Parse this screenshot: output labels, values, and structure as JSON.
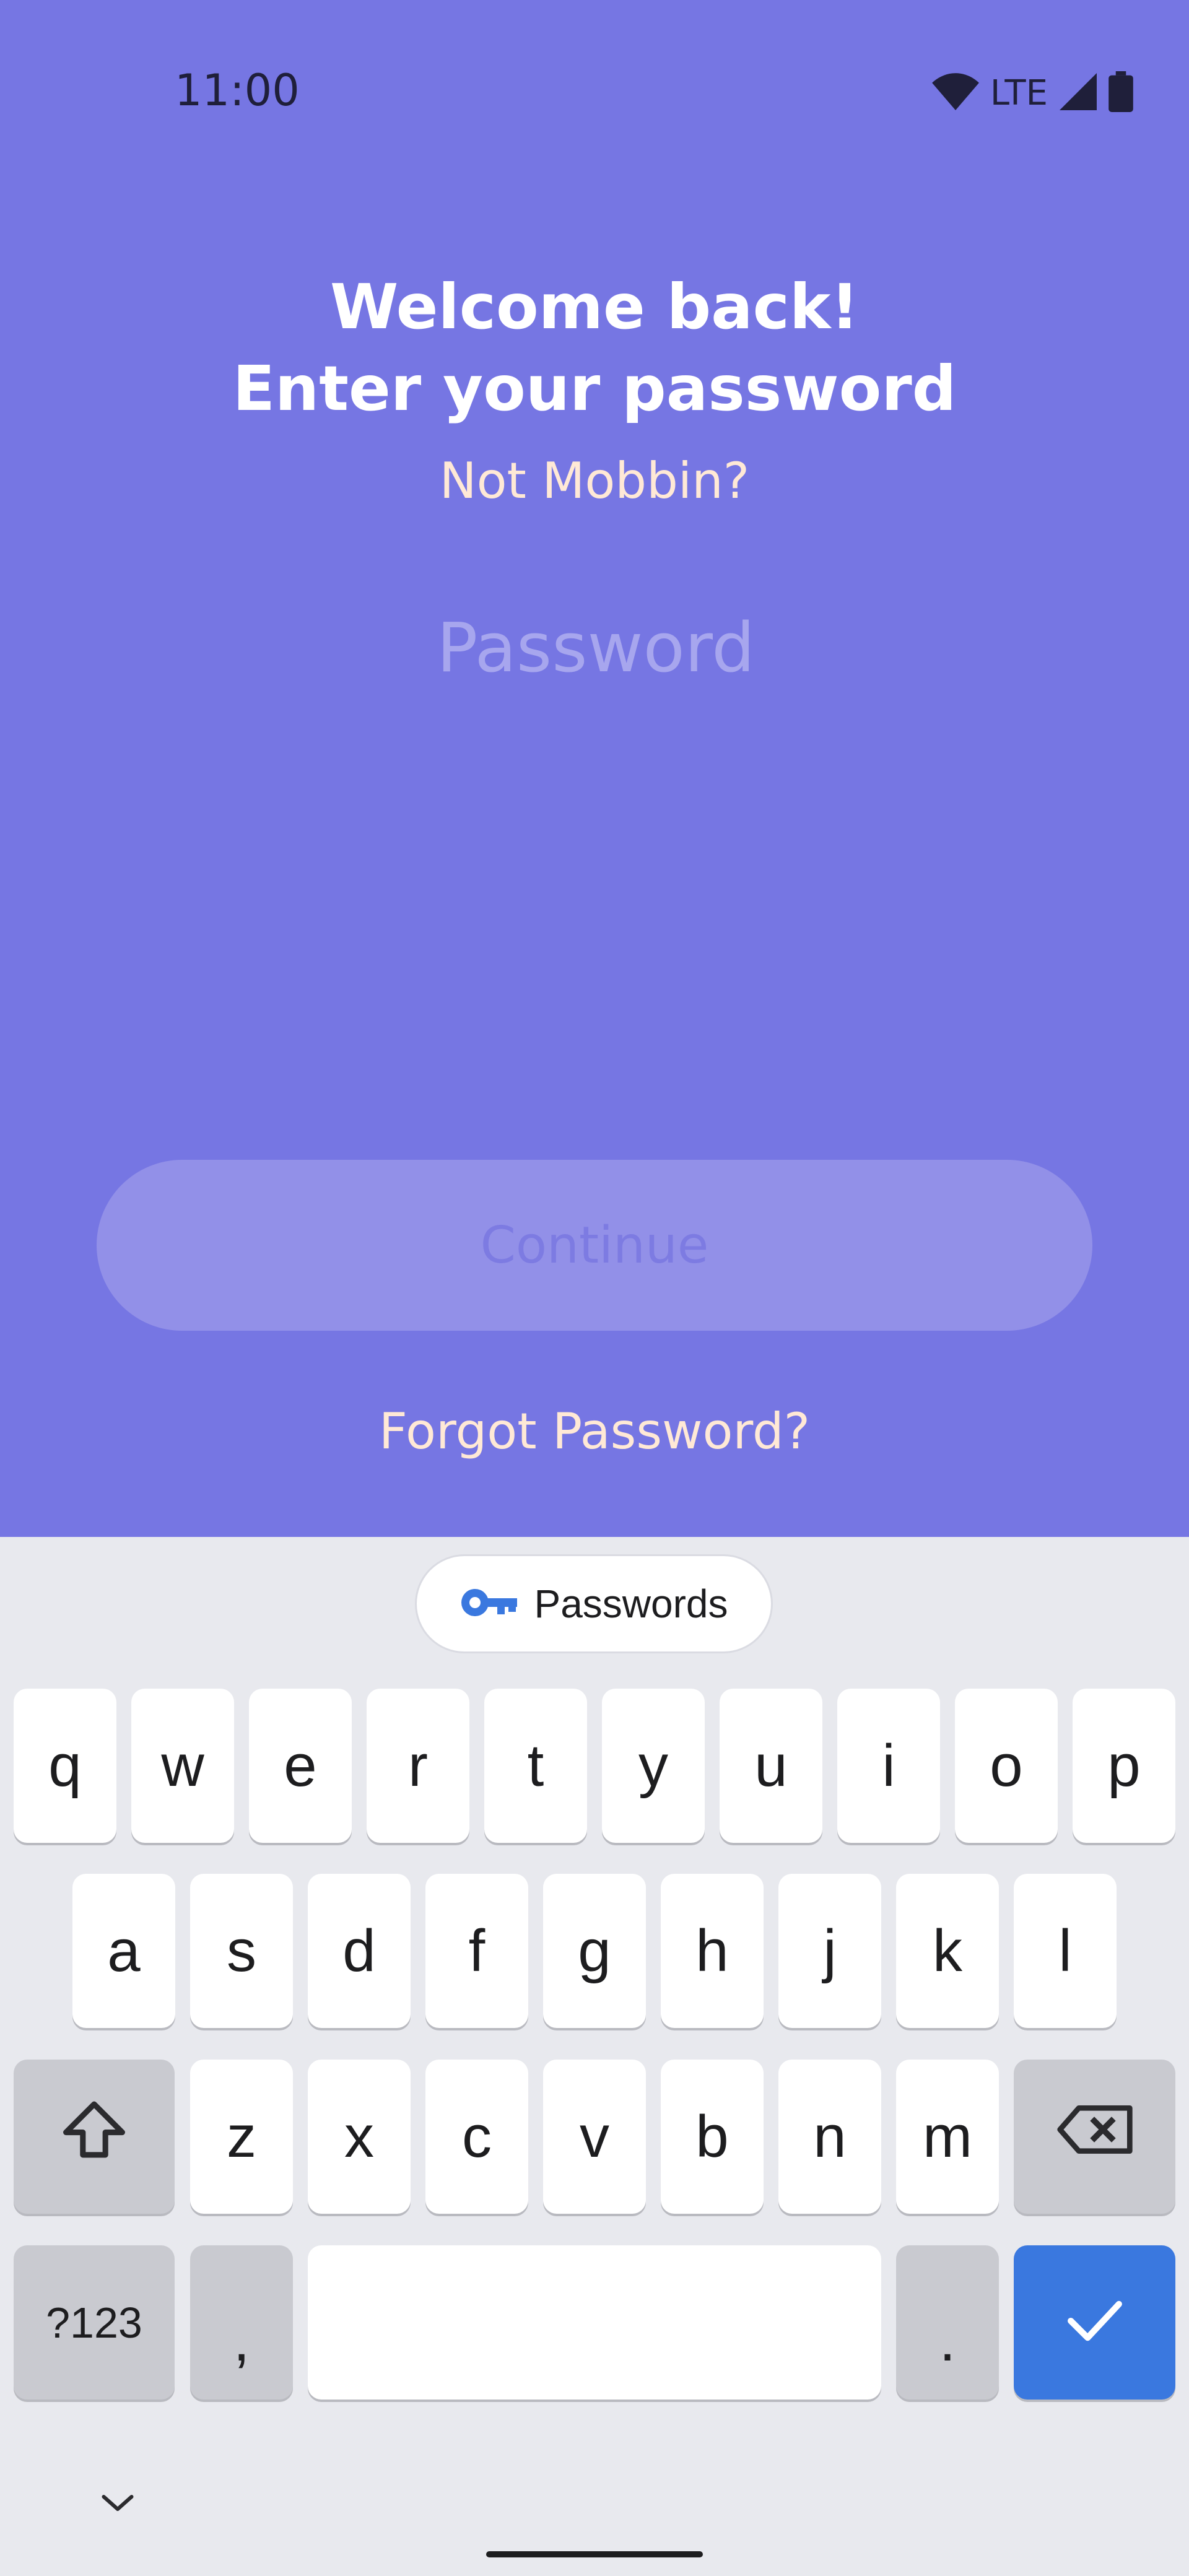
{
  "status_bar": {
    "time": "11:00",
    "network": "LTE",
    "icons": [
      "wifi-icon",
      "signal-icon",
      "battery-icon"
    ]
  },
  "login": {
    "title_line1": "Welcome back!",
    "title_line2": "Enter your password",
    "not_user_link": "Not Mobbin?",
    "password_placeholder": "Password",
    "password_value": "",
    "continue_label": "Continue",
    "forgot_link": "Forgot Password?"
  },
  "keyboard": {
    "suggestion_chip": {
      "label": "Passwords",
      "icon": "key-icon"
    },
    "row1": [
      "q",
      "w",
      "e",
      "r",
      "t",
      "y",
      "u",
      "i",
      "o",
      "p"
    ],
    "row2": [
      "a",
      "s",
      "d",
      "f",
      "g",
      "h",
      "j",
      "k",
      "l"
    ],
    "row3": [
      "z",
      "x",
      "c",
      "v",
      "b",
      "n",
      "m"
    ],
    "symbols_key": "?123",
    "comma_key": ",",
    "period_key": ".",
    "accent_color": "#3a78df"
  },
  "colors": {
    "background": "#7676e3",
    "link": "#ffe9d6",
    "button": "#9290e8"
  }
}
